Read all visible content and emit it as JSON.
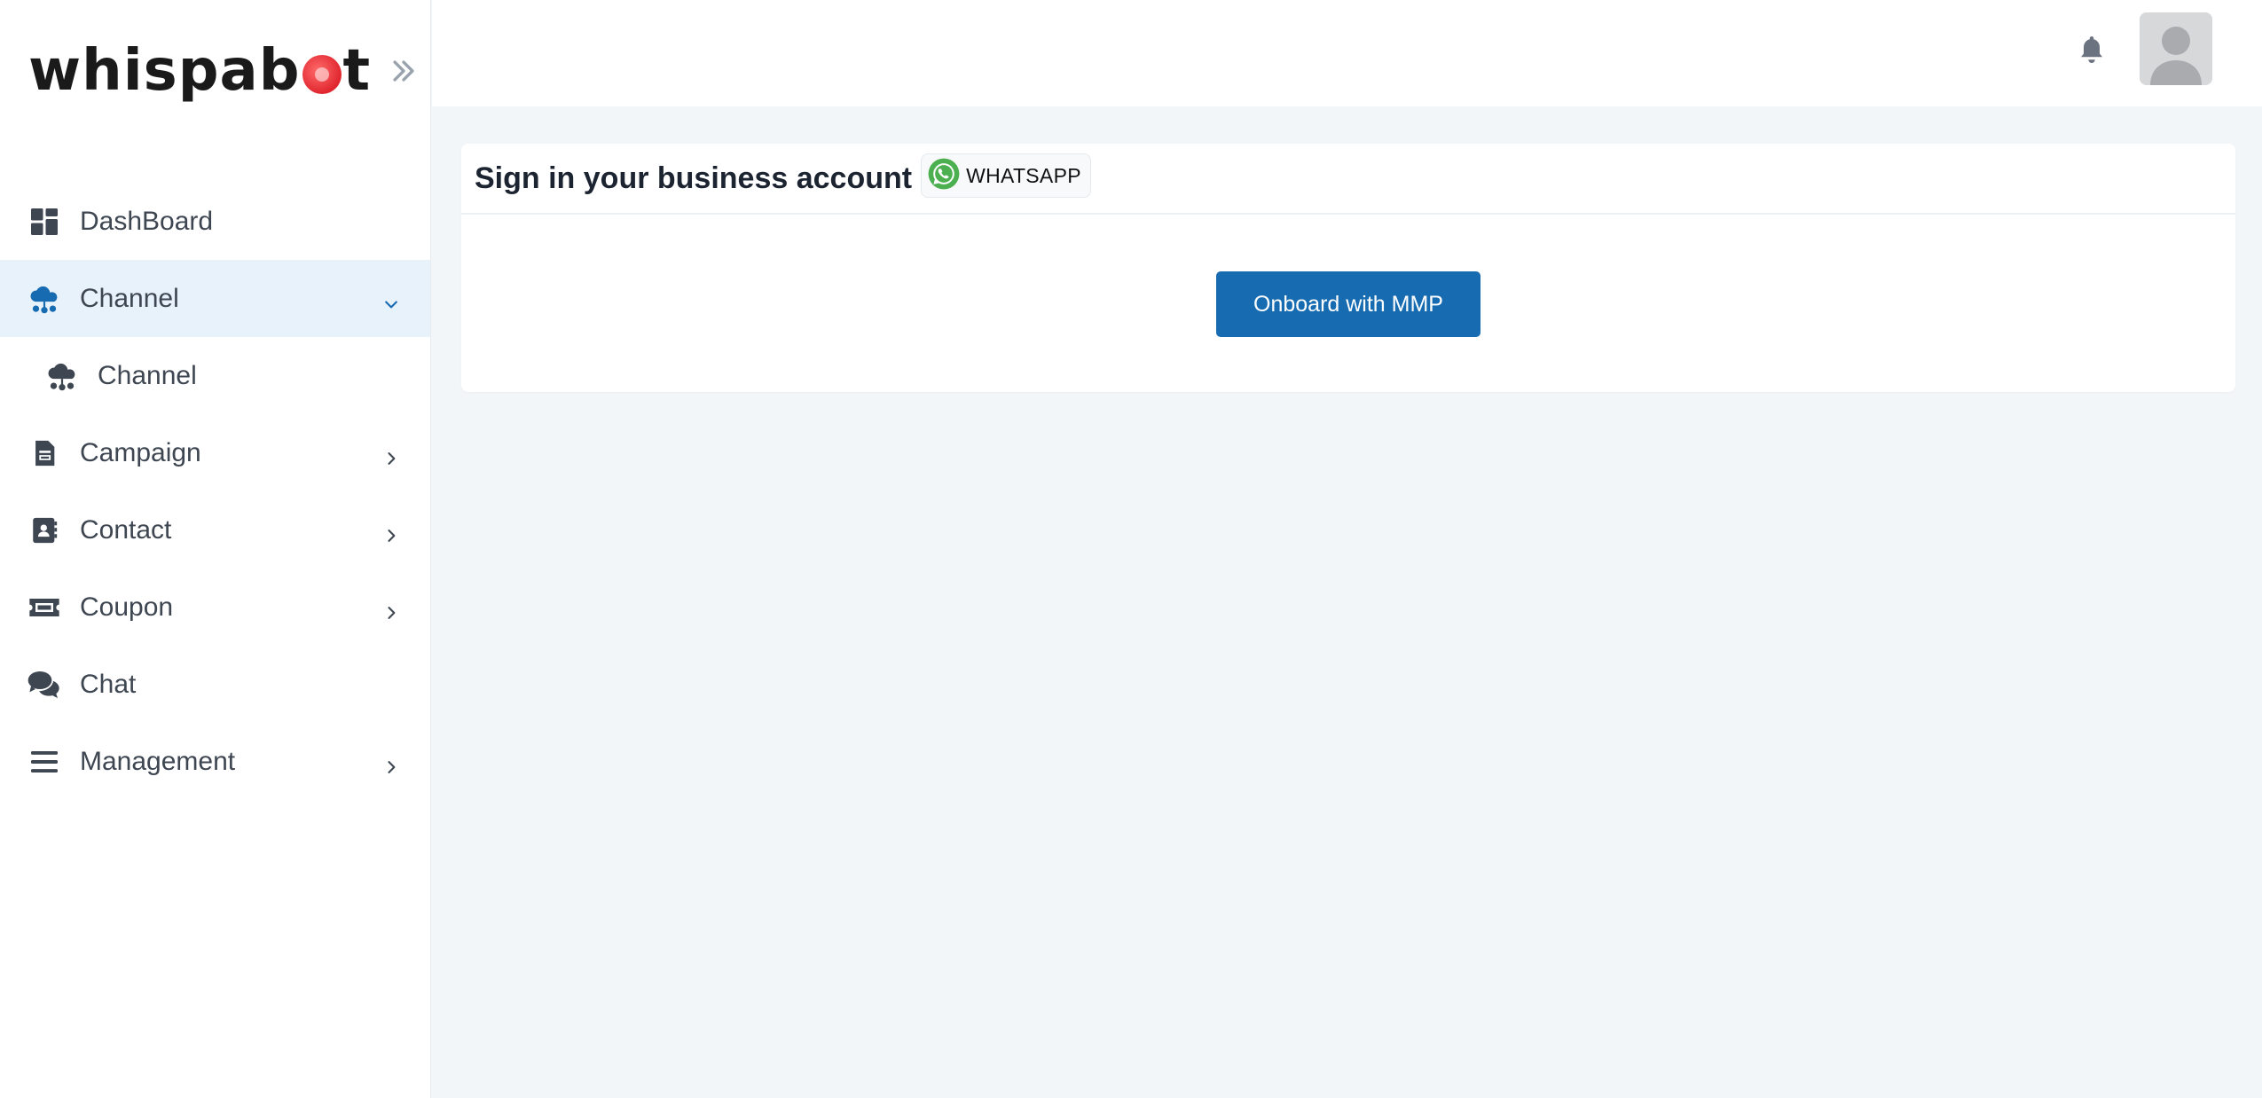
{
  "app": {
    "logo_text_before": "whispab",
    "logo_text_after": "t",
    "accent_color": "#176bb1",
    "logo_color": "#e0262e"
  },
  "sidebar": {
    "items": [
      {
        "label": "DashBoard",
        "icon": "dashboard-grid-icon",
        "has_children": false
      },
      {
        "label": "Channel",
        "icon": "cloud-network-icon",
        "has_children": true,
        "expanded": true,
        "active": true
      },
      {
        "label": "Channel",
        "icon": "cloud-network-icon",
        "sub_item": true
      },
      {
        "label": "Campaign",
        "icon": "document-icon",
        "has_children": true
      },
      {
        "label": "Contact",
        "icon": "contact-book-icon",
        "has_children": true
      },
      {
        "label": "Coupon",
        "icon": "ticket-icon",
        "has_children": true
      },
      {
        "label": "Chat",
        "icon": "chat-bubbles-icon",
        "has_children": false
      },
      {
        "label": "Management",
        "icon": "menu-bars-icon",
        "has_children": true
      }
    ]
  },
  "topbar": {
    "notification_icon": "bell-icon",
    "avatar_icon": "user-avatar-icon"
  },
  "main": {
    "card_title": "Sign in your business account",
    "badge_label": "WHATSAPP",
    "onboard_button": "Onboard with MMP"
  }
}
